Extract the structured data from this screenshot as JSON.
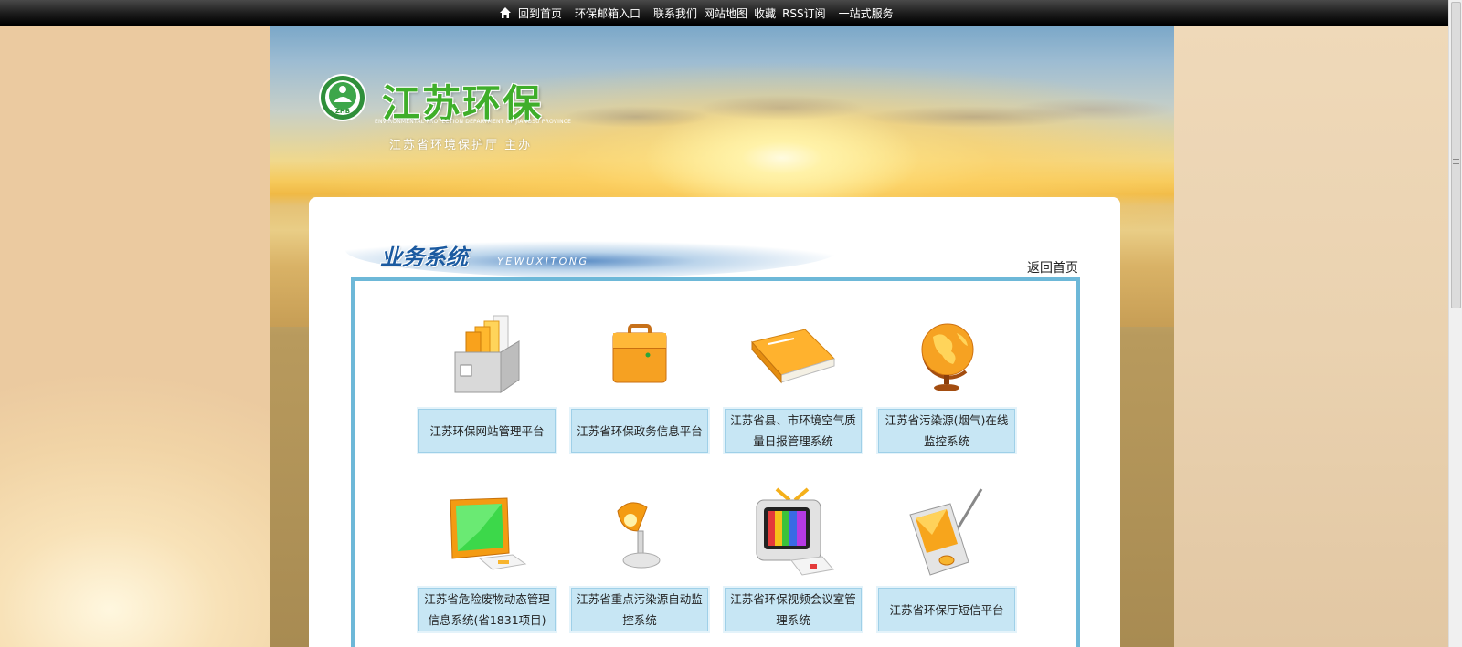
{
  "topbar": {
    "nav": [
      {
        "label": "回到首页",
        "icon": "home-icon"
      },
      {
        "label": "环保邮箱入口"
      },
      {
        "label": "联系我们"
      },
      {
        "label": "网站地图"
      },
      {
        "label": "收藏"
      },
      {
        "label": "RSS订阅"
      },
      {
        "label": "一站式服务"
      }
    ]
  },
  "header": {
    "logo_title": "江苏环保",
    "logo_en": "ENVIRONMENTAL PROTECTION DEPARTMENT OF JIANGSU PROVINCE",
    "logo_sub": "江苏省环境保护厅  主办",
    "emblem_text": "ZHB"
  },
  "section": {
    "title": "业务系统",
    "title_en": "YEWUXITONG",
    "back_label": "返回首页"
  },
  "systems": [
    {
      "label": "江苏环保网站管理平台",
      "icon": "file-box-icon"
    },
    {
      "label": "江苏省环保政务信息平台",
      "icon": "briefcase-icon"
    },
    {
      "label": "江苏省县、市环境空气质量日报管理系统",
      "icon": "book-icon"
    },
    {
      "label": "江苏省污染源(烟气)在线监控系统",
      "icon": "globe-icon"
    },
    {
      "label": "江苏省危险废物动态管理信息系统(省1831项目)",
      "icon": "monitor-icon"
    },
    {
      "label": "江苏省重点污染源自动监控系统",
      "icon": "desk-lamp-icon"
    },
    {
      "label": "江苏省环保视频会议室管理系统",
      "icon": "tv-icon"
    },
    {
      "label": "江苏省环保厅短信平台",
      "icon": "pda-icon"
    }
  ],
  "colors": {
    "accent_blue": "#1b5aa0",
    "panel_border": "#6db8d8",
    "label_bg": "#c7e6f4",
    "logo_green": "#3fae2a",
    "icon_orange": "#f5a623"
  }
}
